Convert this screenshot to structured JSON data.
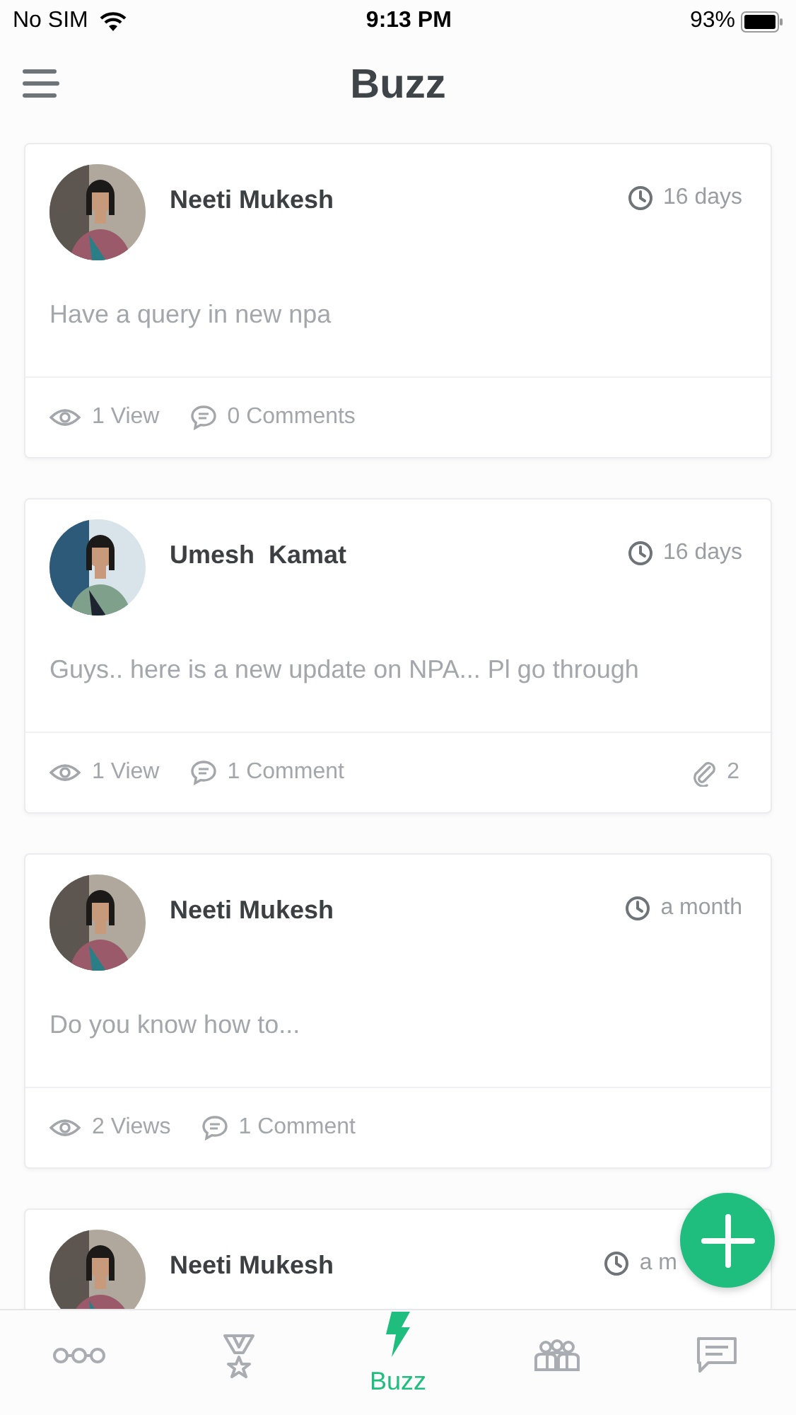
{
  "status_bar": {
    "carrier": "No SIM",
    "time": "9:13 PM",
    "battery": "93%"
  },
  "header": {
    "title": "Buzz"
  },
  "posts": [
    {
      "author": "Neeti Mukesh",
      "time": "16 days",
      "text": "Have a query in new npa",
      "views": "1 View",
      "comments": "0 Comments"
    },
    {
      "author": "Umesh  Kamat",
      "time": "16 days",
      "text": "Guys.. here is a new update on NPA... Pl go through",
      "views": "1 View",
      "comments": "1 Comment",
      "attachments": "2"
    },
    {
      "author": "Neeti Mukesh",
      "time": "a month",
      "text": "Do you know how to...",
      "views": "2 Views",
      "comments": "1 Comment"
    },
    {
      "author": "Neeti Mukesh",
      "time": "a m"
    }
  ],
  "bottom_nav": [
    {
      "selected": false
    },
    {
      "selected": false
    },
    {
      "label": "Buzz",
      "selected": true
    },
    {
      "selected": false
    },
    {
      "selected": false
    }
  ]
}
